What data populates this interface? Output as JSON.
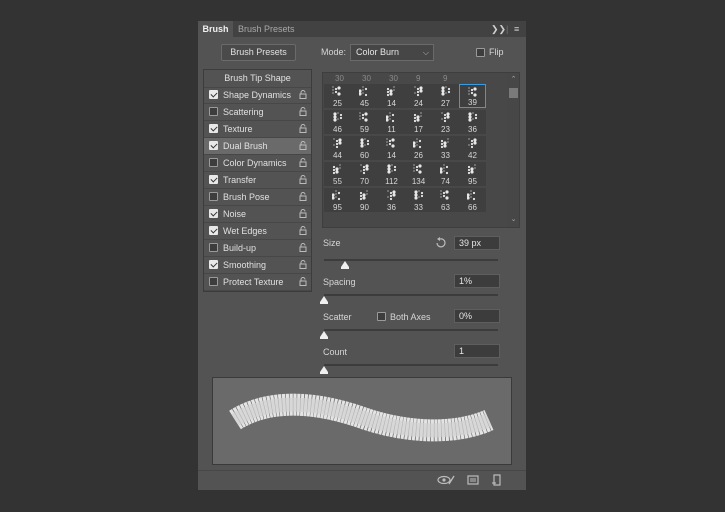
{
  "tabs": {
    "active": "Brush",
    "inactive": "Brush Presets"
  },
  "toolbar": {
    "collapse_icon": "double-chevron-right-icon",
    "menu_icon": "hamburger-menu-icon"
  },
  "presets_button": "Brush Presets",
  "mode": {
    "label": "Mode:",
    "value": "Color Burn"
  },
  "flip": {
    "label": "Flip",
    "checked": false
  },
  "options": {
    "heading": "Brush Tip Shape",
    "items": [
      {
        "label": "Shape Dynamics",
        "checked": true
      },
      {
        "label": "Scattering",
        "checked": false
      },
      {
        "label": "Texture",
        "checked": true
      },
      {
        "label": "Dual Brush",
        "checked": true,
        "selected": true
      },
      {
        "label": "Color Dynamics",
        "checked": false
      },
      {
        "label": "Transfer",
        "checked": true
      },
      {
        "label": "Brush Pose",
        "checked": false
      },
      {
        "label": "Noise",
        "checked": true
      },
      {
        "label": "Wet Edges",
        "checked": true
      },
      {
        "label": "Build-up",
        "checked": false
      },
      {
        "label": "Smoothing",
        "checked": true
      },
      {
        "label": "Protect Texture",
        "checked": false
      }
    ]
  },
  "brush_tips": {
    "top_row": [
      "30",
      "30",
      "30",
      "9",
      "9"
    ],
    "rows": [
      [
        "25",
        "45",
        "14",
        "24",
        "27",
        "39"
      ],
      [
        "46",
        "59",
        "11",
        "17",
        "23",
        "36"
      ],
      [
        "44",
        "60",
        "14",
        "26",
        "33",
        "42"
      ],
      [
        "55",
        "70",
        "112",
        "134",
        "74",
        "95"
      ],
      [
        "95",
        "90",
        "36",
        "33",
        "63",
        "66"
      ]
    ],
    "selected": "39"
  },
  "size": {
    "label": "Size",
    "value": "39 px",
    "slider": 0.12
  },
  "spacing": {
    "label": "Spacing",
    "value": "1%",
    "slider": 0.0
  },
  "scatter": {
    "label": "Scatter",
    "both_axes_label": "Both Axes",
    "both_axes_checked": false,
    "value": "0%",
    "slider": 0.0
  },
  "count": {
    "label": "Count",
    "value": "1",
    "slider": 0.0
  },
  "bottom_icons": [
    "eye-brush-icon",
    "grid-panel-icon",
    "new-brush-icon"
  ]
}
